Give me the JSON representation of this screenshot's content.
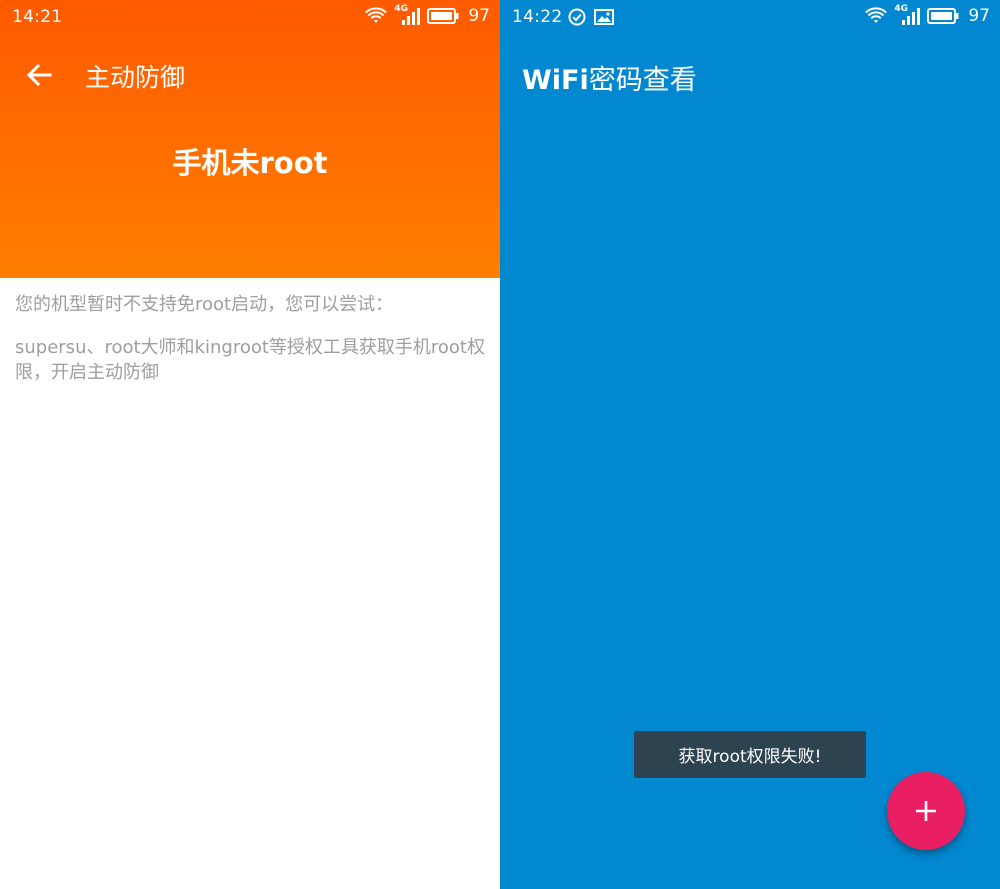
{
  "left_screen": {
    "status_bar": {
      "time": "14:21",
      "network": "4G",
      "battery": "97"
    },
    "header": {
      "title": "主动防御",
      "root_status": "手机未root"
    },
    "body": {
      "line1": "您的机型暂时不支持免root启动，您可以尝试：",
      "line2": "supersu、root大师和kingroot等授权工具获取手机root权限，开启主动防御"
    },
    "colors": {
      "header_top": "#ff5a00",
      "header_bottom": "#ff7f00",
      "body_text": "#9e9e9e"
    }
  },
  "right_screen": {
    "status_bar": {
      "time": "14:22",
      "network": "4G",
      "battery": "97"
    },
    "title_bold": "WiFi",
    "title_rest": "密码查看",
    "toast": "获取root权限失败!",
    "fab_label": "+",
    "colors": {
      "background": "#0288d1",
      "toast": "#2d4350",
      "fab": "#e91e63"
    }
  }
}
